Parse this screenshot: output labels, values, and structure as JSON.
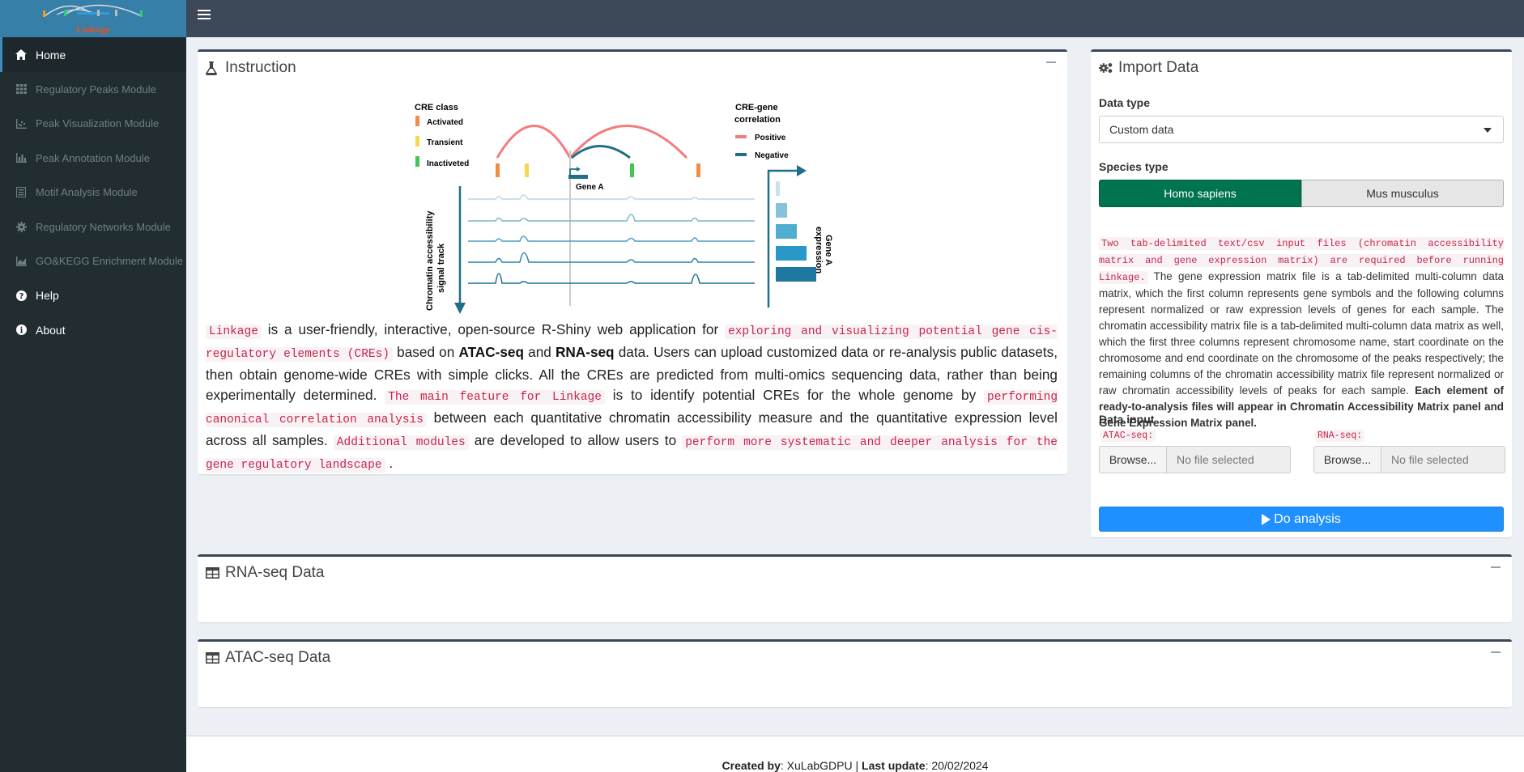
{
  "app": {
    "logo_text": "Linkage",
    "colors": {
      "sidebar_bg": "#222d32",
      "header_bg": "#3c4858",
      "accent_blue": "#1e90ff",
      "species_selected": "#00734f",
      "code_red": "#c7254e"
    }
  },
  "sidebar": {
    "items": [
      {
        "label": "Home",
        "icon": "home-icon"
      },
      {
        "label": "Regulatory Peaks Module",
        "icon": "grid-icon"
      },
      {
        "label": "Peak Visualization Module",
        "icon": "scatter-icon"
      },
      {
        "label": "Peak Annotation Module",
        "icon": "bar-chart-icon"
      },
      {
        "label": "Motif Analysis Module",
        "icon": "list-icon"
      },
      {
        "label": "Regulatory Networks Module",
        "icon": "gear-icon"
      },
      {
        "label": "GO&KEGG Enrichment Module",
        "icon": "area-chart-icon"
      },
      {
        "label": "Help",
        "icon": "question-circle-icon"
      },
      {
        "label": "About",
        "icon": "info-circle-icon"
      }
    ]
  },
  "instruction": {
    "title": "Instruction",
    "figure": {
      "cre_class_title": "CRE class",
      "activated": "Activated",
      "transient": "Transient",
      "inactivated": "Inactiveted",
      "corr_title_1": "CRE-gene",
      "corr_title_2": "correlation",
      "positive": "Positive",
      "negative": "Negative",
      "gene": "Gene A",
      "y_label_1": "Chromatin accessibility",
      "y_label_2": "signal track",
      "expr_label_1": "Gene A",
      "expr_label_2": "expression"
    },
    "desc": {
      "p1_code": "Linkage",
      "p2": " is a user-friendly, interactive, open-source R-Shiny web application for ",
      "p3_code": "exploring and visualizing potential gene cis-regulatory elements (CREs)",
      "p4": " based on ",
      "p5_bold": "ATAC-seq",
      "p6": " and ",
      "p7_bold": "RNA-seq",
      "p8": " data. Users can upload customized data or re-analysis public datasets, then obtain genome-wide CREs with simple clicks. All the CREs are predicted from multi-omics sequencing data, rather than being experimentally determined. ",
      "p9_code": "The main feature for Linkage",
      "p10": " is to identify potential CREs for the whole genome by ",
      "p11_code": "performing canonical correlation analysis",
      "p12": " between each quantitative chromatin accessibility measure and the quantitative expression level across all samples. ",
      "p13_code": "Additional modules",
      "p14": " are developed to allow users to ",
      "p15_code": "perform more systematic and deeper analysis for the gene regulatory landscape",
      "p16": " ."
    }
  },
  "import": {
    "title": "Import Data",
    "data_type_label": "Data type",
    "data_type_value": "Custom data",
    "species_label": "Species type",
    "species_options": [
      "Homo sapiens",
      "Mus musculus"
    ],
    "species_selected": "Homo sapiens",
    "text_code": "Two tab-delimited text/csv input files (chromatin accessibility matrix and gene expression matrix) are required before running Linkage.",
    "text_body": " The gene expression matrix file is a tab-delimited multi-column data matrix, which the first column represents gene symbols and the following columns represent normalized or raw expression levels of genes for each sample. The chromatin accessibility matrix file is a tab-delimited multi-column data matrix as well, which the first three columns represent chromosome name, start coordinate on the chromosome and end coordinate on the chromosome of the peaks respectively; the remaining columns of the chromatin accessibility matrix file represent normalized or raw chromatin accessibility levels of peaks for each sample. ",
    "text_bold": "Each element of ready-to-analysis files will appear in Chromatin Accessibility Matrix panel and Gene Expression Matrix panel.",
    "data_input_label": "Data input",
    "atac_label": "ATAC-seq:",
    "rna_label": "RNA-seq:",
    "browse_label": "Browse...",
    "no_file": "No file selected",
    "do_analysis": "Do analysis"
  },
  "rna_box": {
    "title": "RNA-seq Data"
  },
  "atac_box": {
    "title": "ATAC-seq Data"
  },
  "footer": {
    "created_by_label": "Created by",
    "created_by_value": ": XuLabGDPU | ",
    "last_update_label": "Last update",
    "last_update_value": ": 20/02/2024"
  }
}
